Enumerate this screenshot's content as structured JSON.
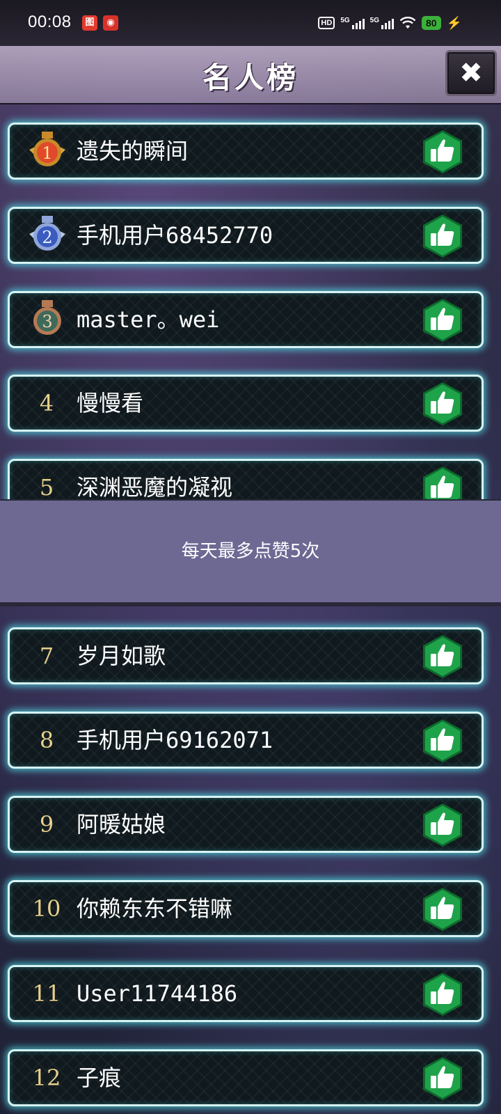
{
  "status_bar": {
    "time": "00:08",
    "network_1": "5G",
    "network_2": "5G",
    "hd_label": "HD",
    "battery": "80",
    "app_icons": [
      "news-app-icon",
      "game-app-icon"
    ]
  },
  "title": "名人榜",
  "close_label": "✖",
  "toast": "每天最多点赞5次",
  "colors": {
    "row_glow": "#50dce6",
    "like_green": "#1fa34a",
    "rank_gold": "#e8cf8a",
    "toast_bg": "#6d6993"
  },
  "rows": [
    {
      "rank": "1",
      "name": "遗失的瞬间",
      "medal": "gold"
    },
    {
      "rank": "2",
      "name": "手机用户68452770",
      "medal": "silver"
    },
    {
      "rank": "3",
      "name": "master。wei",
      "medal": "bronze"
    },
    {
      "rank": "4",
      "name": "慢慢看"
    },
    {
      "rank": "5",
      "name": "深渊恶魔的凝视"
    },
    {
      "rank": "7",
      "name": "岁月如歌"
    },
    {
      "rank": "8",
      "name": "手机用户69162071"
    },
    {
      "rank": "9",
      "name": "阿暖姑娘"
    },
    {
      "rank": "10",
      "name": "你赖东东不错嘛"
    },
    {
      "rank": "11",
      "name": "User11744186"
    },
    {
      "rank": "12",
      "name": "子痕"
    }
  ]
}
